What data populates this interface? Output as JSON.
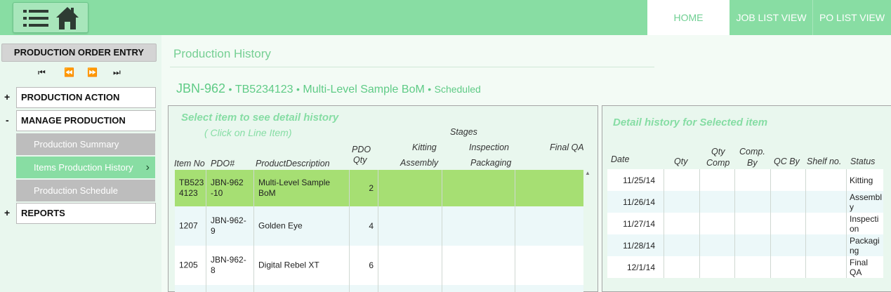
{
  "topbar": {
    "tabs": [
      {
        "label": "HOME"
      },
      {
        "label": "JOB LIST VIEW"
      },
      {
        "label": "PO LIST VIEW"
      }
    ]
  },
  "sidebar": {
    "header": "PRODUCTION ORDER ENTRY",
    "pager": {
      "first": "⏮",
      "prev": "⏪",
      "next": "⏩",
      "last": "⏭"
    },
    "sections": [
      {
        "sign": "+",
        "label": "PRODUCTION ACTION"
      },
      {
        "sign": "-",
        "label": "MANAGE PRODUCTION"
      },
      {
        "sign": "+",
        "label": "REPORTS"
      }
    ],
    "sub_items": [
      {
        "label": "Production Summary"
      },
      {
        "label": "Items Production History",
        "chevron": "›"
      },
      {
        "label": "Production Schedule"
      }
    ]
  },
  "main": {
    "title": "Production History",
    "job": {
      "code": "JBN-962",
      "sep": "•",
      "ref": "TB5234123",
      "desc": "Multi-Level Sample BoM",
      "status": "Scheduled"
    }
  },
  "left_panel": {
    "title": "Select item to see detail history",
    "subtitle": "( Click on Line Item)",
    "stages_label": "Stages",
    "headers": {
      "item_no": "Item No",
      "pdo": "PDO#",
      "desc": "ProductDescription",
      "pdo_qty_1": "PDO",
      "pdo_qty_2": "Qty",
      "kitting": "Kitting",
      "assembly": "Assembly",
      "inspection": "Inspection",
      "packaging": "Packaging",
      "final_qa": "Final QA"
    },
    "rows": [
      {
        "item_no": "TB523 4123",
        "pdo": "JBN-962 -10",
        "desc": "Multi-Level Sample BoM",
        "qty": "2"
      },
      {
        "item_no": "1207",
        "pdo": "JBN-962-9",
        "desc": "Golden Eye",
        "qty": "4"
      },
      {
        "item_no": "1205",
        "pdo": "JBN-962-8",
        "desc": "Digital Rebel XT",
        "qty": "6"
      }
    ],
    "scroll_up": "▲"
  },
  "right_panel": {
    "title": "Detail history for Selected item",
    "headers": {
      "date": "Date",
      "qty": "Qty",
      "qty_comp_1": "Qty",
      "qty_comp_2": "Comp",
      "comp_by_1": "Comp.",
      "comp_by_2": "By",
      "qc_by": "QC By",
      "shelf": "Shelf no.",
      "status": "Status"
    },
    "rows": [
      {
        "date": "11/25/14",
        "status": "Kitting"
      },
      {
        "date": "11/26/14",
        "status": "Assembl y"
      },
      {
        "date": "11/27/14",
        "status": "Inspecti on"
      },
      {
        "date": "11/28/14",
        "status": "Packagi ng"
      },
      {
        "date": "12/1/14",
        "status": "Final QA"
      }
    ]
  },
  "colors": {
    "brand_green": "#88dda3",
    "selected_row": "#a6df73",
    "light_bg": "#e9f7ee"
  }
}
